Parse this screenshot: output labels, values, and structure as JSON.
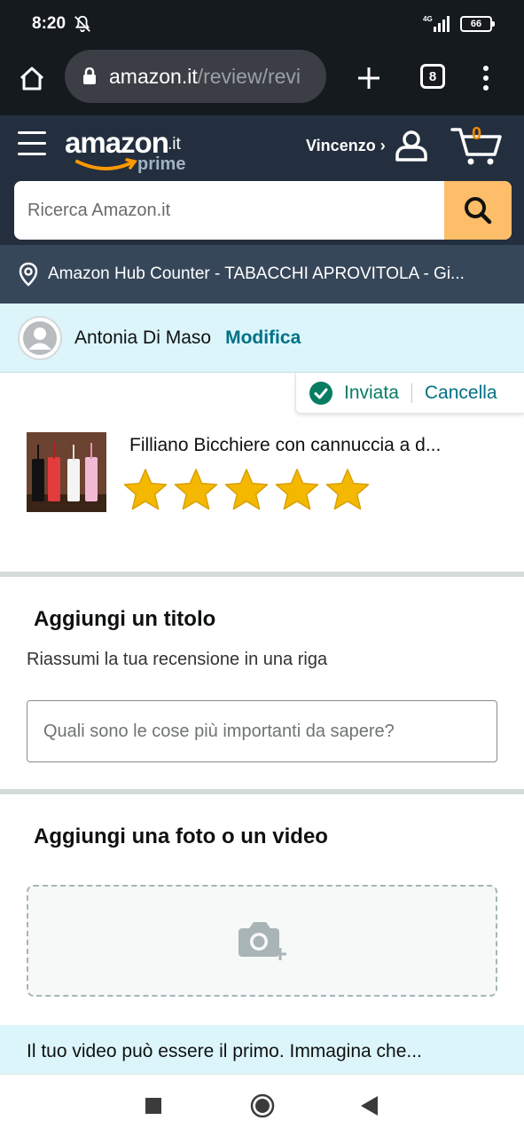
{
  "status_bar": {
    "time": "8:20",
    "network": "4G",
    "battery": "66"
  },
  "browser": {
    "url_domain": "amazon.it",
    "url_path": "/review/revi",
    "tab_count": "8"
  },
  "header": {
    "logo_text": "amazon",
    "logo_tld": ".it",
    "logo_sub": "prime",
    "account_name": "Vincenzo ›",
    "cart_count": "0"
  },
  "search": {
    "placeholder": "Ricerca Amazon.it"
  },
  "location": {
    "text": "Amazon Hub Counter - TABACCHI APROVITOLA - Gi..."
  },
  "reviewer": {
    "name": "Antonia Di Maso",
    "edit_label": "Modifica"
  },
  "submission": {
    "status_label": "Inviata",
    "cancel_label": "Cancella"
  },
  "product": {
    "title": "Filliano Bicchiere con cannuccia a d...",
    "rating": 5,
    "rating_max": 5
  },
  "title_section": {
    "heading": "Aggiungi un titolo",
    "subheading": "Riassumi la tua recensione in una riga",
    "input_placeholder": "Quali sono le cose più importanti da sapere?"
  },
  "media_section": {
    "heading": "Aggiungi una foto o un video",
    "upload_icon": "camera-add-icon"
  },
  "video_hint": {
    "text": "Il tuo video può essere il primo. Immagina che..."
  },
  "colors": {
    "amazon_dark": "#232f3e",
    "amazon_orange": "#febd69",
    "teal_link": "#007185",
    "success_green": "#067d62",
    "star_gold": "#f5b800"
  }
}
